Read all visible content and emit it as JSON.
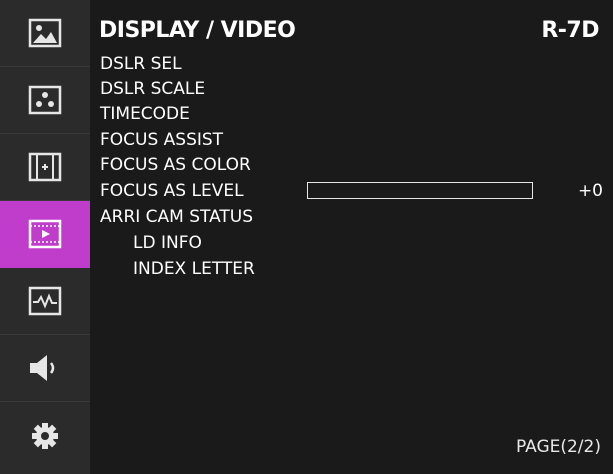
{
  "theme": {
    "accent": "#c03ccb"
  },
  "sidebar": {
    "items": [
      {
        "icon": "image-icon",
        "active": false
      },
      {
        "icon": "dots-icon",
        "active": false
      },
      {
        "icon": "marker-frame-icon",
        "active": false
      },
      {
        "icon": "video-play-icon",
        "active": true
      },
      {
        "icon": "waveform-icon",
        "active": false
      },
      {
        "icon": "speaker-icon",
        "active": false
      },
      {
        "icon": "gear-icon",
        "active": false
      }
    ]
  },
  "header": {
    "title": "DISPLAY / VIDEO",
    "model": "R-7D"
  },
  "menu": {
    "items": [
      {
        "label": "DSLR SEL"
      },
      {
        "label": "DSLR SCALE"
      },
      {
        "label": "TIMECODE"
      },
      {
        "label": "FOCUS ASSIST"
      },
      {
        "label": "FOCUS AS COLOR"
      },
      {
        "label": "FOCUS AS LEVEL"
      },
      {
        "label": "ARRI CAM STATUS"
      },
      {
        "label": "LD INFO"
      },
      {
        "label": "INDEX LETTER"
      }
    ]
  },
  "focus_level": {
    "value_text": "+0",
    "fill_fraction": 0
  },
  "footer": {
    "page": "PAGE(2/2)"
  }
}
